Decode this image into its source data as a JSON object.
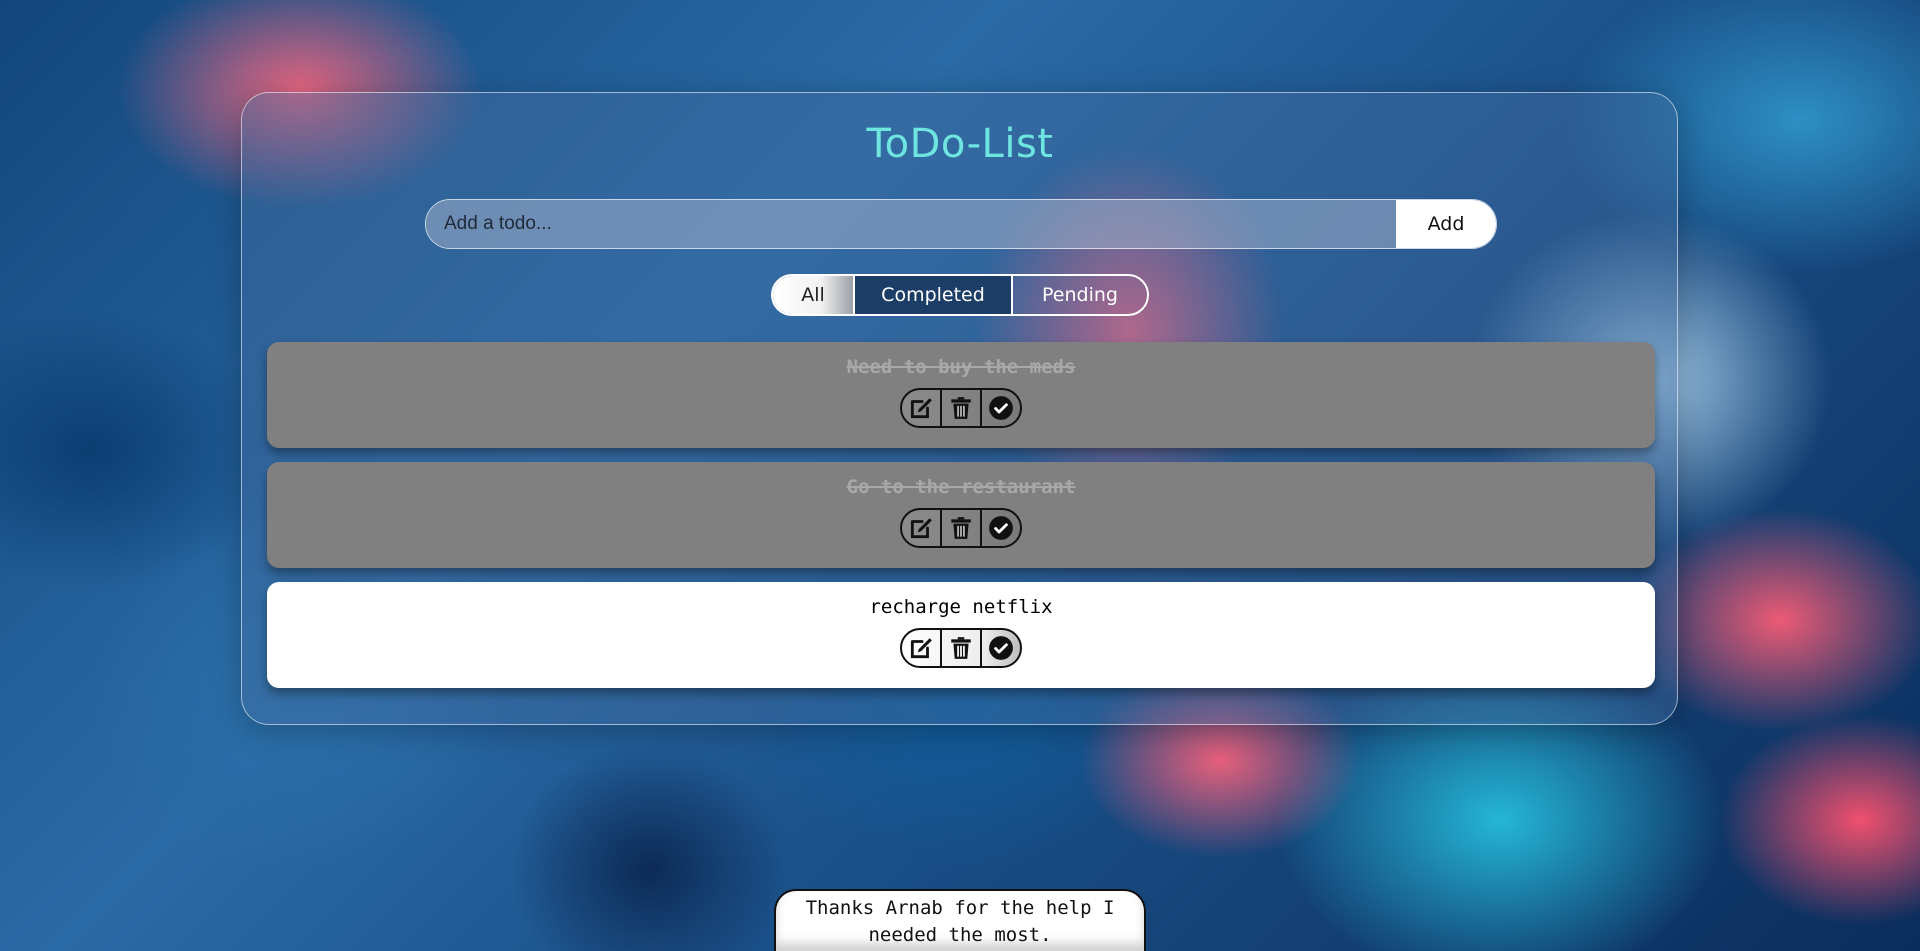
{
  "app": {
    "title": "ToDo-List"
  },
  "add_form": {
    "placeholder": "Add a todo...",
    "value": "",
    "button_label": "Add"
  },
  "filters": [
    {
      "label": "All",
      "active": true
    },
    {
      "label": "Completed",
      "active": false
    },
    {
      "label": "Pending",
      "active": false
    }
  ],
  "todos": [
    {
      "text": "Need to buy the meds",
      "completed": true,
      "icons": [
        "edit-icon",
        "trash-icon",
        "check-circle-icon"
      ]
    },
    {
      "text": "Go to the restaurant",
      "completed": true,
      "icons": [
        "edit-icon",
        "trash-icon",
        "check-circle-icon"
      ]
    },
    {
      "text": "recharge netflix",
      "completed": false,
      "icons": [
        "edit-icon",
        "trash-icon",
        "check-circle-icon"
      ]
    }
  ],
  "footer": {
    "message": "Thanks Arnab for the help I needed the most."
  },
  "colors": {
    "title": "#6ee5de",
    "completed_item": "#808080",
    "pending_item": "#ffffff",
    "active_filter": "#1b3d66"
  }
}
